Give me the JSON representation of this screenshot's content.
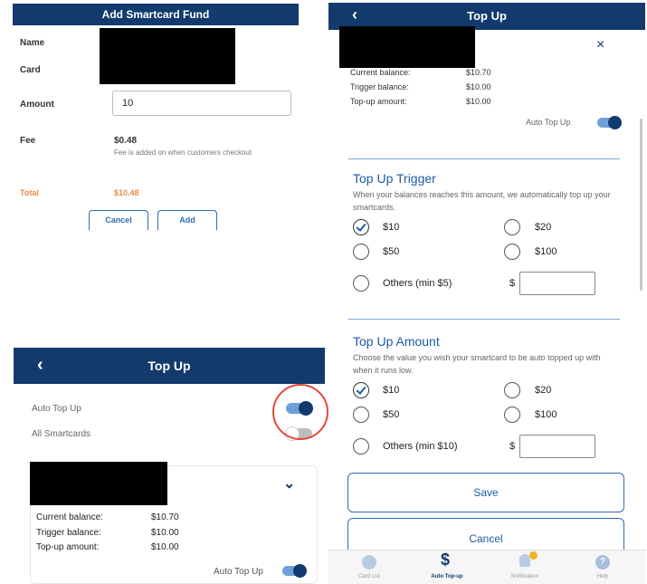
{
  "add_fund": {
    "title": "Add Smartcard Fund",
    "name_label": "Name",
    "card_label": "Card",
    "amount_label": "Amount",
    "amount_value": "10",
    "fee_label": "Fee",
    "fee_value": "$0.48",
    "fee_note": "Fee is added on when customers checkout",
    "total_label": "Total",
    "total_value": "$10.48",
    "cancel_label": "Cancel",
    "add_label": "Add"
  },
  "topup_left": {
    "back": "‹",
    "title": "Top Up",
    "auto_topup_label": "Auto Top Up",
    "auto_topup_on": true,
    "all_smartcards_label": "All Smartcards",
    "all_smartcards_on": false,
    "chevron": "⌄",
    "current_balance_label": "Current balance:",
    "current_balance_value": "$10.70",
    "trigger_balance_label": "Trigger balance:",
    "trigger_balance_value": "$10.00",
    "topup_amount_label": "Top-up amount:",
    "topup_amount_value": "$10.00",
    "card_auto_topup_label": "Auto Top Up",
    "card_auto_topup_on": true
  },
  "topup_right": {
    "back": "‹",
    "title": "Top Up",
    "close": "×",
    "current_balance_label": "Current balance:",
    "current_balance_value": "$10.70",
    "trigger_balance_label": "Trigger balance:",
    "trigger_balance_value": "$10.00",
    "topup_amount_label": "Top-up amount:",
    "topup_amount_value": "$10.00",
    "auto_topup_label": "Auto Top Up",
    "auto_topup_on": true,
    "trigger_section": {
      "title": "Top Up Trigger",
      "description": "When your balances reaches this amount, we automatically top up your smartcards.",
      "options": [
        "$10",
        "$20",
        "$50",
        "$100"
      ],
      "selected": "$10",
      "others_label": "Others (min $5)",
      "others_currency": "$",
      "others_value": ""
    },
    "amount_section": {
      "title": "Top Up Amount",
      "description": "Choose the value you wish your smartcard to be auto topped up with when it runs low.",
      "options": [
        "$10",
        "$20",
        "$50",
        "$100"
      ],
      "selected": "$10",
      "others_label": "Others (min $10)",
      "others_currency": "$",
      "others_value": ""
    },
    "save_label": "Save",
    "cancel_label": "Cancel",
    "nav": {
      "dollar_glyph": "$",
      "help_glyph": "?",
      "items": [
        "Card List",
        "Auto Top-up",
        "Notification",
        "Help"
      ],
      "active": "Auto Top-up"
    }
  },
  "colors": {
    "header": "#123a6d",
    "accent": "#1d5aa6",
    "total": "#e98a4a",
    "highlight_circle": "#e2483d",
    "toggle_track_on": "#6f9fd6"
  }
}
